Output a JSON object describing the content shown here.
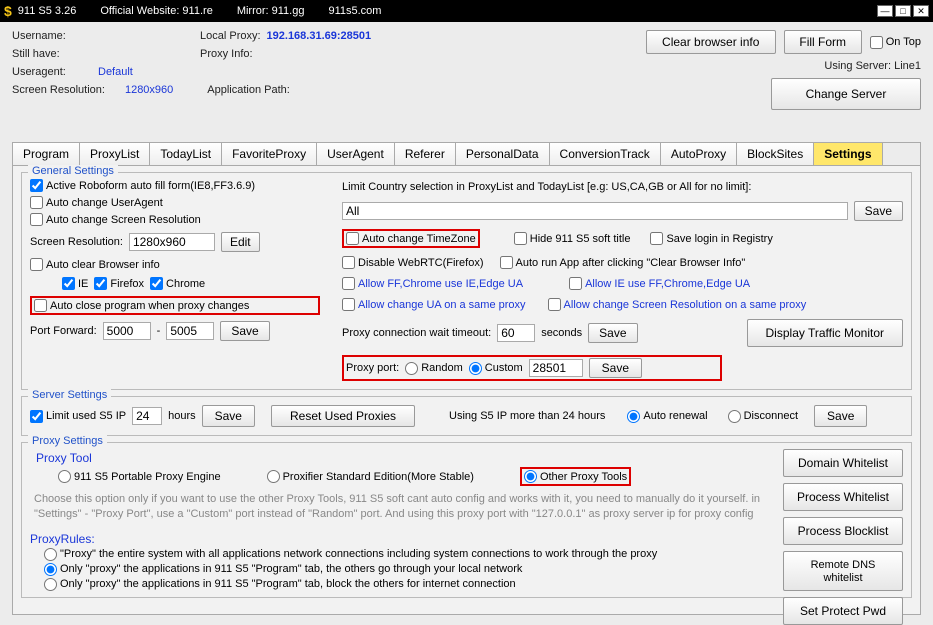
{
  "title": {
    "app": "911 S5 3.26",
    "site": "Official Website:  911.re",
    "mirror": "Mirror:  911.gg",
    "alt": "911s5.com"
  },
  "hdr": {
    "username_lbl": "Username:",
    "local_proxy_lbl": "Local Proxy:",
    "local_proxy_val": "192.168.31.69:28501",
    "still_lbl": "Still have:",
    "proxy_info_lbl": "Proxy Info:",
    "ua_lbl": "Useragent:",
    "ua_val": "Default",
    "res_lbl": "Screen Resolution:",
    "res_val": "1280x960",
    "app_path_lbl": "Application Path:",
    "clear": "Clear browser info",
    "fill": "Fill Form",
    "ontop": "On Top",
    "using": "Using Server: Line1",
    "change": "Change Server"
  },
  "tabs": [
    "Program",
    "ProxyList",
    "TodayList",
    "FavoriteProxy",
    "UserAgent",
    "Referer",
    "PersonalData",
    "ConversionTrack",
    "AutoProxy",
    "BlockSites",
    "Settings"
  ],
  "gs": {
    "legend": "General Settings",
    "roboform": "Active Roboform auto fill form(IE8,FF3.6.9)",
    "auto_ua": "Auto change UserAgent",
    "auto_res": "Auto change Screen Resolution",
    "sr_lbl": "Screen Resolution:",
    "sr_val": "1280x960",
    "edit": "Edit",
    "autoclear": "Auto clear Browser info",
    "ie": "IE",
    "ff": "Firefox",
    "ch": "Chrome",
    "autoclose": "Auto close program when proxy changes",
    "pf": "Port Forward:",
    "pf1": "5000",
    "dash": "-",
    "pf2": "5005",
    "save": "Save",
    "limit_lbl": "Limit Country selection in ProxyList and TodayList [e.g:  US,CA,GB  or All for no limit]:",
    "limit_val": "All",
    "auto_tz": "Auto change TimeZone",
    "hide": "Hide 911 S5 soft title",
    "save_reg": "Save login in Registry",
    "disable_rtc": "Disable WebRTC(Firefox)",
    "autorun": "Auto run App after clicking \"Clear Browser Info\"",
    "allow_ff": "Allow FF,Chrome use IE,Edge UA",
    "allow_ie": "Allow IE use FF,Chrome,Edge UA",
    "allow_same": "Allow change UA on a same proxy",
    "allow_sr": "Allow change Screen Resolution on a same proxy",
    "pcw_lbl": "Proxy connection wait timeout:",
    "pcw_val": "60",
    "sec": "seconds",
    "pp_lbl": "Proxy port:",
    "random": "Random",
    "custom": "Custom",
    "pp_val": "28501",
    "dtm": "Display Traffic Monitor"
  },
  "ss": {
    "legend": "Server Settings",
    "limit": "Limit used S5 IP",
    "hours": "24",
    "hours_lbl": "hours",
    "save": "Save",
    "reset": "Reset Used Proxies",
    "more": "Using S5 IP more than 24 hours",
    "auto": "Auto renewal",
    "disc": "Disconnect"
  },
  "ps": {
    "legend": "Proxy Settings",
    "tool": "Proxy Tool",
    "r1": "911 S5 Portable Proxy Engine",
    "r2": "Proxifier Standard Edition(More Stable)",
    "r3": "Other Proxy Tools",
    "desc": "Choose this option only if you want to use the other Proxy Tools, 911 S5 soft cant auto config and works with it, you need to manually do it yourself. in \"Settings\" - \"Proxy Port\", use a \"Custom\" port instead of \"Random\" port. And using this proxy port with \"127.0.0.1\" as proxy server ip for proxy config",
    "rules": "ProxyRules:",
    "p1": "\"Proxy\" the entire system with all applications network connections including system connections to work through the proxy",
    "p2": "Only \"proxy\" the applications in 911 S5 \"Program\" tab, the others go through your local network",
    "p3": "Only \"proxy\" the applications in 911 S5 \"Program\" tab, block the others for internet connection",
    "b1": "Domain Whitelist",
    "b2": "Process Whitelist",
    "b3": "Process Blocklist",
    "b4a": "Remote DNS",
    "b4b": "whitelist",
    "b5": "Set Protect Pwd"
  }
}
